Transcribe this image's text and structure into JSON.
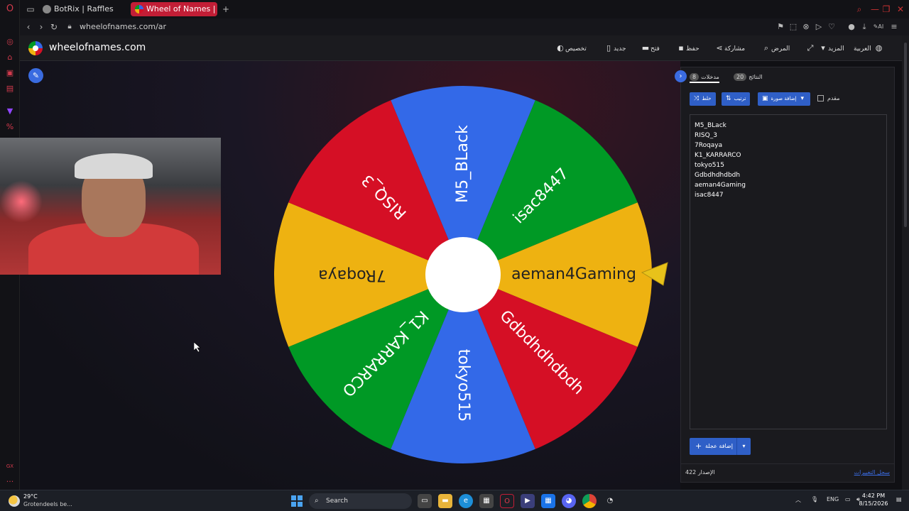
{
  "browser": {
    "tabs": [
      {
        "label": "BotRix | Raffles",
        "active": false
      },
      {
        "label": "Wheel of Names | العشوائي",
        "active": true
      }
    ],
    "new_tab": "+",
    "url": "wheelofnames.com/ar"
  },
  "site": {
    "title": "wheelofnames.com",
    "menu": [
      "العربية",
      "المزيد",
      "",
      "المرض",
      "مشاركة",
      "حفظ",
      "فتح",
      "جديد",
      "تخصيص"
    ]
  },
  "wheel": {
    "segments": [
      {
        "name": "M5_BLack",
        "color": "#3369e8"
      },
      {
        "name": "isac8447",
        "color": "#009925"
      },
      {
        "name": "aeman4Gaming",
        "color": "#eeb211"
      },
      {
        "name": "Gdbdhdhdbdh",
        "color": "#d50f25"
      },
      {
        "name": "tokyo515",
        "color": "#3369e8"
      },
      {
        "name": "K1_KARRARCO",
        "color": "#009925"
      },
      {
        "name": "7Roqaya",
        "color": "#eeb211"
      },
      {
        "name": "RISQ_3",
        "color": "#d50f25"
      }
    ]
  },
  "panel": {
    "tab_entries": {
      "label": "مدخلات",
      "count": "8"
    },
    "tab_results": {
      "label": "النتائج",
      "count": "20"
    },
    "shuffle_label": "خلط",
    "sort_label": "ترتيب",
    "add_image_label": "إضافة صورة",
    "advanced_label": "مقدم",
    "entries": [
      "M5_BLack",
      "RISQ_3",
      "7Roqaya",
      "K1_KARRARCO",
      "tokyo515",
      "Gdbdhdhdbdh",
      "aeman4Gaming",
      "isac8447"
    ],
    "add_wheel_label": "إضافة عجلة",
    "version": "422 الإصدار",
    "changelog": "سجل التغييرات"
  },
  "taskbar": {
    "weather_temp": "29°C",
    "weather_desc": "Grotendeels be...",
    "search": "Search",
    "lang": "ENG",
    "time": "4:42 PM",
    "date": "8/15/2026"
  }
}
